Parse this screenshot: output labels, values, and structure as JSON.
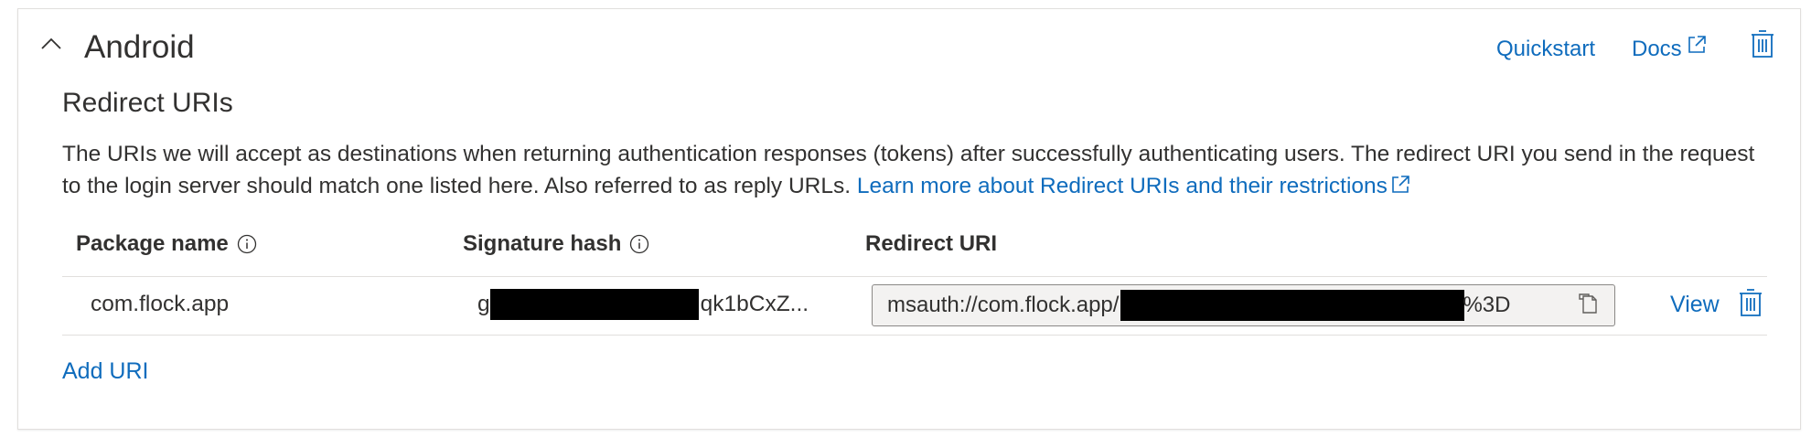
{
  "section": {
    "title": "Android",
    "quickstart_label": "Quickstart",
    "docs_label": "Docs"
  },
  "redirect": {
    "title": "Redirect URIs",
    "description": "The URIs we will accept as destinations when returning authentication responses (tokens) after successfully authenticating users. The redirect URI you send in the request to the login server should match one listed here. Also referred to as reply URLs. ",
    "learn_more_label": "Learn more about Redirect URIs and their restrictions"
  },
  "table": {
    "headers": {
      "package_name": "Package name",
      "signature_hash": "Signature hash",
      "redirect_uri": "Redirect URI"
    },
    "rows": [
      {
        "package_name": "com.flock.app",
        "signature_prefix": "g",
        "signature_suffix": "qk1bCxZ...",
        "uri_prefix": "msauth://com.flock.app/",
        "uri_suffix": "%3D",
        "view_label": "View"
      }
    ]
  },
  "add_uri_label": "Add URI",
  "colors": {
    "link": "#0f6cbd",
    "text": "#323130",
    "border": "#e1dfdd",
    "field_bg": "#f3f2f1"
  },
  "icons": [
    "chevron-up-icon",
    "external-link-icon",
    "trash-icon",
    "info-icon",
    "copy-icon"
  ]
}
